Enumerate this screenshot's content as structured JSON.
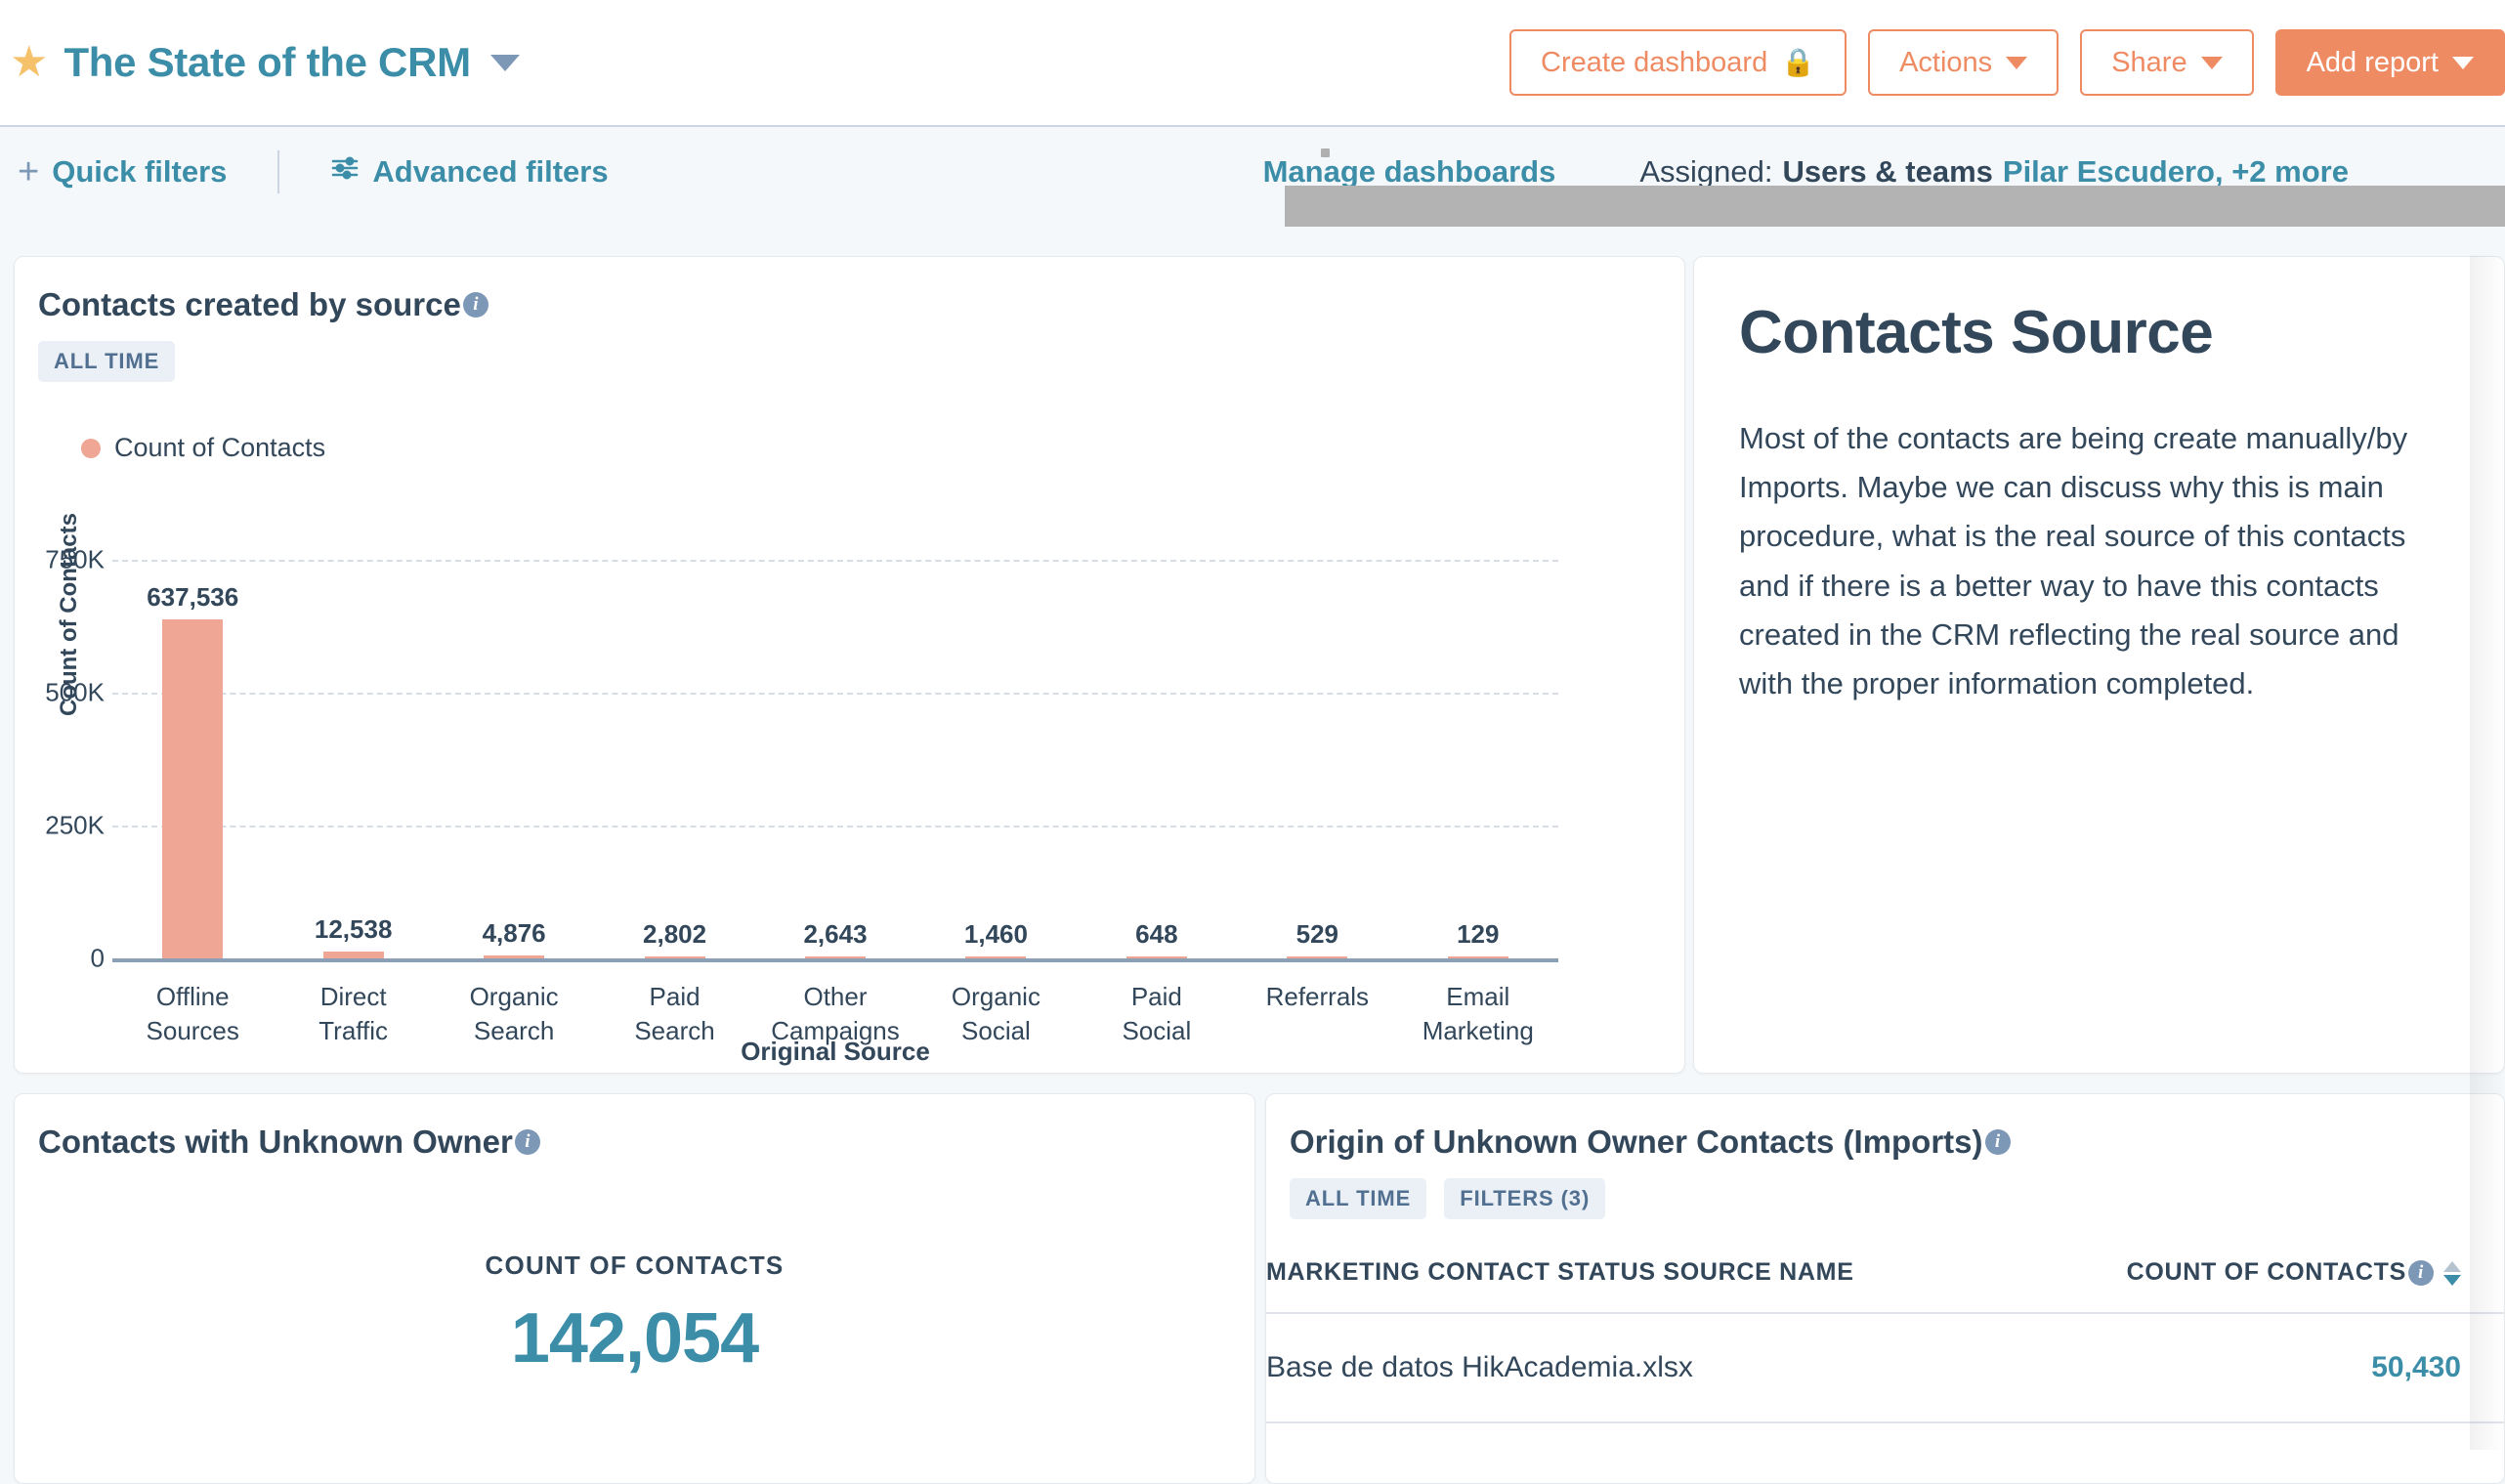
{
  "header": {
    "star_icon": "star-icon",
    "dashboard_title": "The State of the CRM",
    "buttons": {
      "create_dashboard": "Create dashboard",
      "create_dashboard_icon": "lock-icon",
      "actions": "Actions",
      "share": "Share",
      "add_report": "Add report"
    }
  },
  "filter_bar": {
    "quick_filters": "Quick filters",
    "quick_filters_icon": "plus-icon",
    "advanced_filters": "Advanced filters",
    "advanced_filters_icon": "sliders-icon",
    "manage_dashboards": "Manage dashboards",
    "assigned_label": "Assigned:",
    "assigned_value": "Users & teams",
    "assigned_more": "Pilar Escudero, +2 more"
  },
  "chart_card": {
    "title": "Contacts created by source",
    "info_icon": "info-icon",
    "chips": [
      "ALL TIME"
    ],
    "legend": "Count of Contacts"
  },
  "note_card": {
    "title": "Contacts Source",
    "body": "Most of the contacts are being create manually/by Imports. Maybe we can discuss why this is main procedure, what is the real source of this contacts and if there is a better way to have this contacts created in the CRM reflecting the real source and with the proper information completed."
  },
  "kpi_card": {
    "title": "Contacts with Unknown Owner",
    "info_icon": "info-icon",
    "caption": "COUNT OF CONTACTS",
    "value": "142,054"
  },
  "table_card": {
    "title": "Origin of Unknown Owner Contacts (Imports)",
    "info_icon": "info-icon",
    "chips": [
      "ALL TIME",
      "FILTERS (3)"
    ],
    "columns": [
      "MARKETING CONTACT STATUS SOURCE NAME",
      "COUNT OF CONTACTS"
    ],
    "rows": [
      {
        "name": "Base de datos HikAcademia.xlsx",
        "count": "50,430"
      }
    ]
  },
  "colors": {
    "brand_teal": "#3b8da8",
    "accent_orange": "#ef8b63",
    "bar_salmon": "#efa694",
    "text_dark": "#33475b",
    "page_bg": "#f5f8fa",
    "star_gold": "#f5c26b"
  },
  "chart_data": {
    "type": "bar",
    "title": "Contacts created by source",
    "xlabel": "Original Source",
    "ylabel": "Count of Contacts",
    "categories": [
      "Offline Sources",
      "Direct Traffic",
      "Organic Search",
      "Paid Search",
      "Other Campaigns",
      "Organic Social",
      "Paid Social",
      "Referrals",
      "Email Marketing"
    ],
    "values": [
      637536,
      12538,
      4876,
      2802,
      2643,
      1460,
      648,
      529,
      129
    ],
    "value_labels": [
      "637,536",
      "12,538",
      "4,876",
      "2,802",
      "2,643",
      "1,460",
      "648",
      "529",
      "129"
    ],
    "series": [
      {
        "name": "Count of Contacts",
        "color": "#efa694",
        "values": [
          637536,
          12538,
          4876,
          2802,
          2643,
          1460,
          648,
          529,
          129
        ]
      }
    ],
    "ylim": [
      0,
      750000
    ],
    "yticks": [
      0,
      250000,
      500000,
      750000
    ],
    "ytick_labels": [
      "0",
      "250K",
      "500K",
      "750K"
    ],
    "grid": true,
    "legend": [
      "Count of Contacts"
    ],
    "legend_position": "top-left"
  }
}
